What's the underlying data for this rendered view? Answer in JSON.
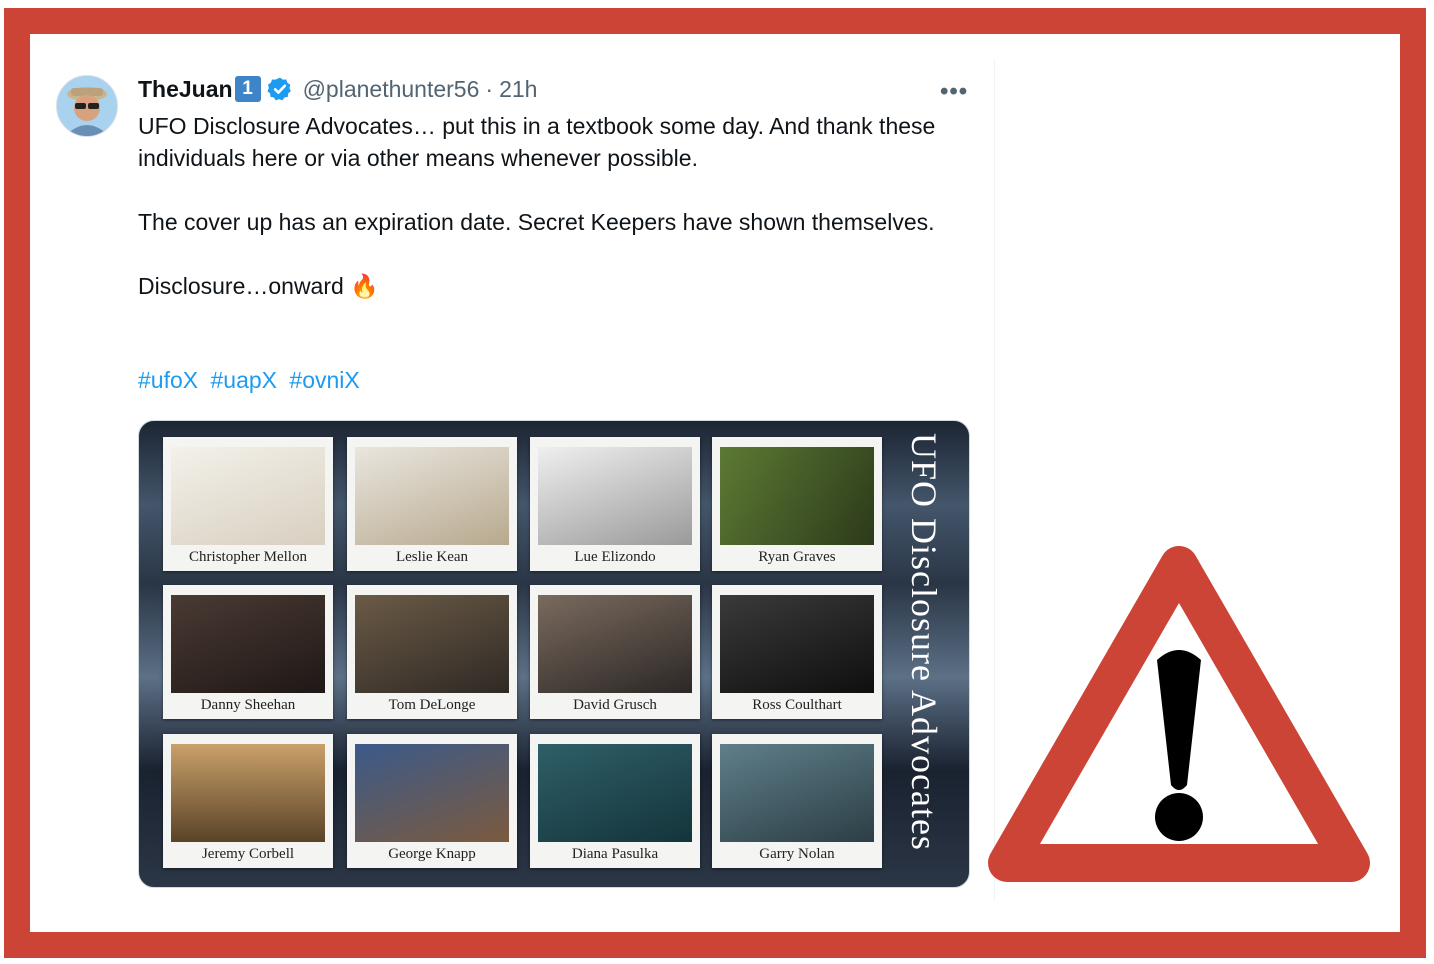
{
  "tweet": {
    "display_name": "TheJuan",
    "name_badge": "1",
    "handle": "@planethunter56",
    "separator": "·",
    "time": "21h",
    "more_label": "•••",
    "paragraphs": [
      "UFO Disclosure Advocates… put this in a textbook some day. And thank these individuals here or via other means whenever possible.",
      "The cover up has an expiration date. Secret Keepers have shown themselves.",
      "Disclosure…onward 🔥"
    ],
    "hashtags": [
      "#ufoX",
      "#uapX",
      "#ovniX"
    ]
  },
  "media": {
    "title": "UFO Disclosure Advocates",
    "people": [
      "Christopher Mellon",
      "Leslie Kean",
      "Lue Elizondo",
      "Ryan Graves",
      "Danny Sheehan",
      "Tom DeLonge",
      "David Grusch",
      "Ross Coulthart",
      "Jeremy Corbell",
      "George Knapp",
      "Diana Pasulka",
      "Garry Nolan"
    ]
  },
  "icons": {
    "verified": "verified-badge-icon",
    "more": "more-options-icon",
    "warning": "warning-triangle-icon"
  },
  "colors": {
    "frame_border": "#cc4436",
    "hashtag": "#1d9bf0",
    "verified": "#1d9bf0",
    "text": "#0f1419",
    "muted": "#536471"
  }
}
